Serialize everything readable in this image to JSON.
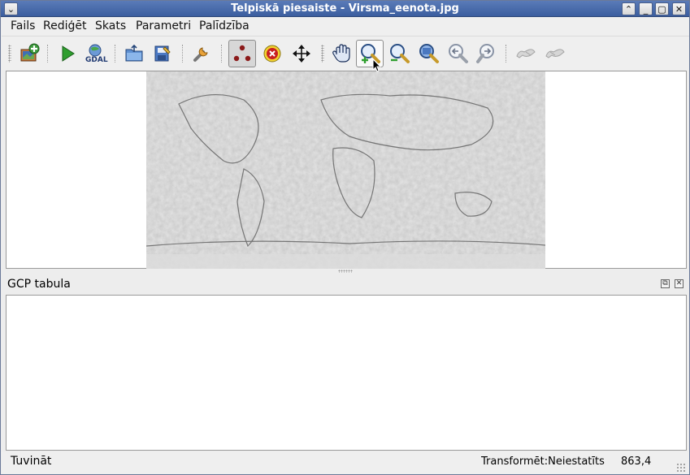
{
  "window": {
    "title": "Telpiskā piesaiste - Virsma_eenota.jpg",
    "title_bar_color": "#3b5e9f"
  },
  "menu": {
    "items": [
      {
        "label": "Fails"
      },
      {
        "label": "Rediģēt"
      },
      {
        "label": "Skats"
      },
      {
        "label": "Parametri"
      },
      {
        "label": "Palīdzība"
      }
    ]
  },
  "toolbar": {
    "buttons": [
      {
        "icon": "open-raster-icon"
      },
      {
        "icon": "start-georeferencing-icon"
      },
      {
        "icon": "gdal-script-icon"
      },
      {
        "icon": "load-gcp-icon"
      },
      {
        "icon": "save-gcp-icon"
      },
      {
        "icon": "transformation-settings-icon"
      },
      {
        "icon": "add-point-icon",
        "state": "active"
      },
      {
        "icon": "delete-point-icon"
      },
      {
        "icon": "move-point-icon"
      },
      {
        "icon": "pan-icon"
      },
      {
        "icon": "zoom-in-icon",
        "state": "hover"
      },
      {
        "icon": "zoom-out-icon"
      },
      {
        "icon": "zoom-to-layer-icon"
      },
      {
        "icon": "zoom-last-icon"
      },
      {
        "icon": "zoom-next-icon"
      },
      {
        "icon": "link-georeferencer-icon",
        "state": "disabled"
      },
      {
        "icon": "link-qgis-icon",
        "state": "disabled"
      }
    ]
  },
  "canvas": {
    "raster": "world-relief-map"
  },
  "gcp_dock": {
    "title": "GCP tabula"
  },
  "status": {
    "message": "Tuvināt",
    "transform": "Transformēt:Neiestatīts",
    "coords": "863,4"
  }
}
